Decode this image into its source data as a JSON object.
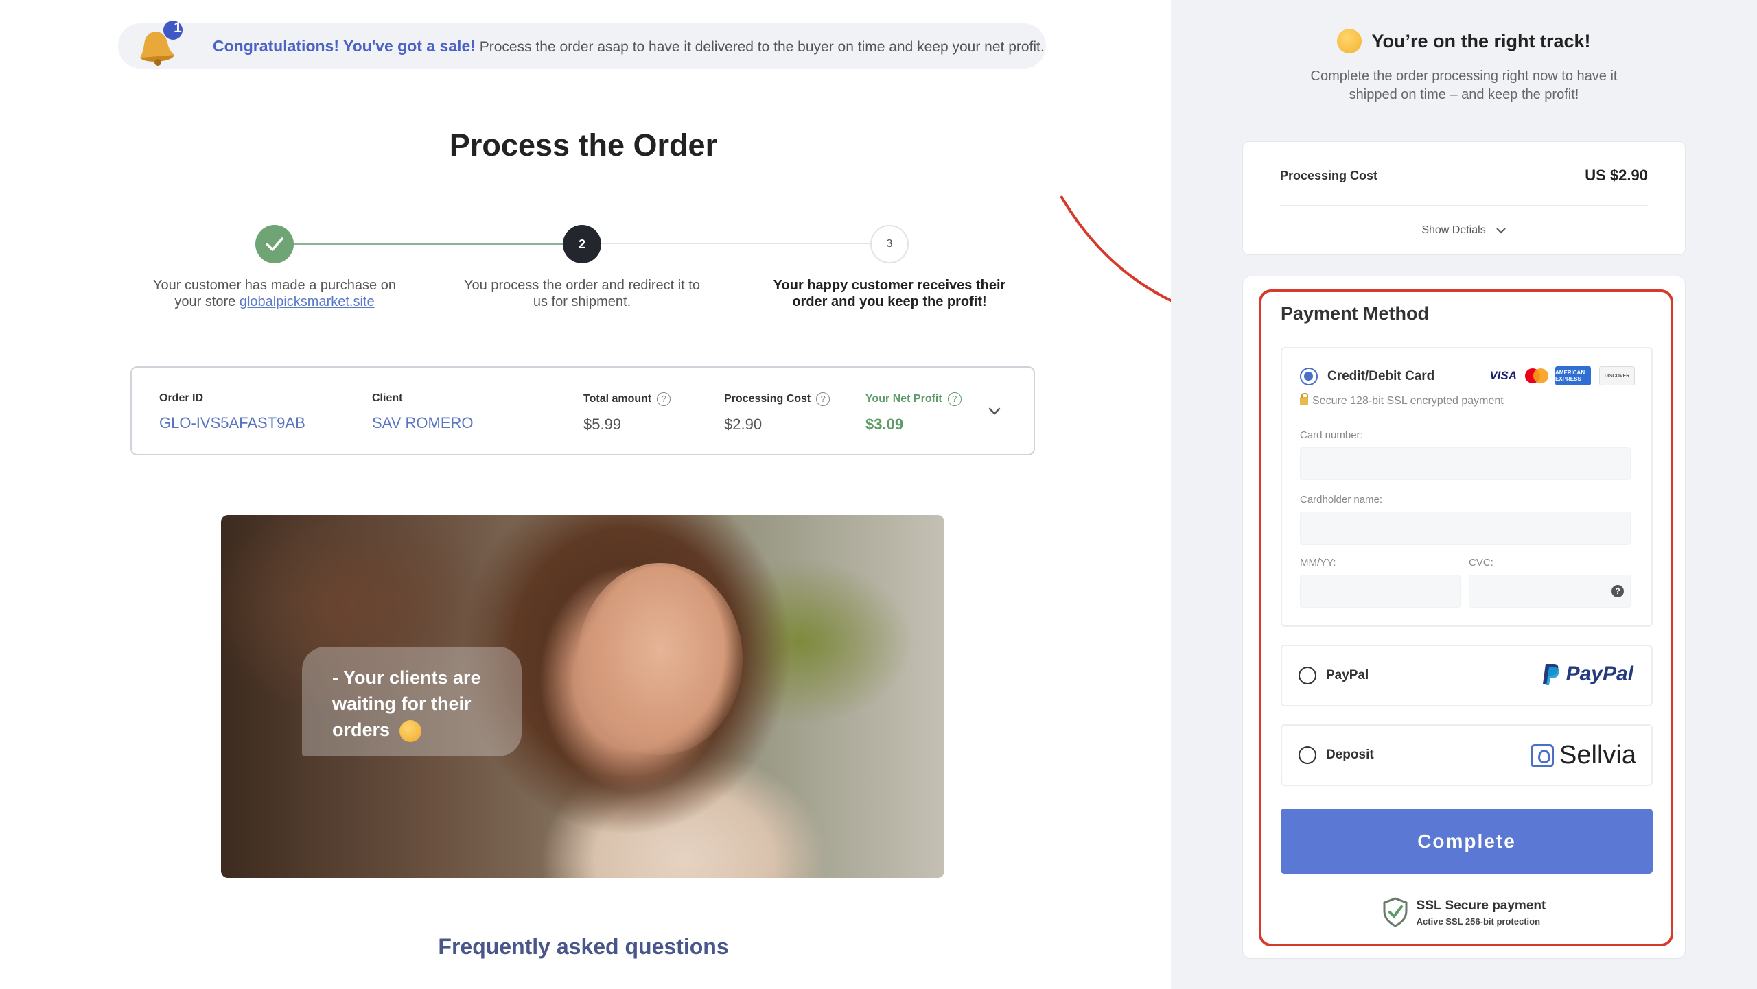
{
  "banner": {
    "badge": "1",
    "highlight": "Congratulations! You've got a sale!",
    "message": "Process the order asap to have it delivered to the buyer on time and keep your net profit."
  },
  "page": {
    "title": "Process the Order"
  },
  "steps": [
    {
      "number": "",
      "line1": "Your customer has made a purchase on",
      "line2_prefix": "your store ",
      "link": "globalpicksmarket.site",
      "state": "done"
    },
    {
      "number": "2",
      "line1": "You process the order and redirect it to",
      "line2": "us for shipment.",
      "state": "current"
    },
    {
      "number": "3",
      "line1": "Your happy customer receives their",
      "line2": "order and you keep the profit!",
      "state": "upcoming"
    }
  ],
  "order": {
    "order_id_label": "Order ID",
    "order_id": "GLO-IVS5AFAST9AB",
    "client_label": "Client",
    "client": "SAV ROMERO",
    "total_label": "Total amount",
    "total": "$5.99",
    "processing_label": "Processing Cost",
    "processing": "$2.90",
    "profit_label": "Your Net Profit",
    "profit": "$3.09"
  },
  "hero": {
    "bubble_text": "- Your clients are waiting for their orders"
  },
  "faq": {
    "title": "Frequently asked questions"
  },
  "side": {
    "title": "You’re on the right track!",
    "subtitle_line1": "Complete the order processing right now to have it",
    "subtitle_line2": "shipped on time – and keep the profit!",
    "cost_label": "Processing Cost",
    "cost_value": "US $2.90",
    "show_details": "Show Detials",
    "payment_title": "Payment Method",
    "card_option": "Credit/Debit Card",
    "ssl_note": "Secure 128-bit SSL encrypted payment",
    "card_number_label": "Card number:",
    "cardholder_label": "Cardholder name:",
    "expiry_label": "MM/YY:",
    "cvc_label": "CVC:",
    "paypal_option": "PayPal",
    "paypal_logo": "PayPal",
    "deposit_option": "Deposit",
    "sellvia_logo": "Sellvia",
    "complete_button": "Complete",
    "ssl_title": "SSL Secure payment",
    "ssl_sub": "Active SSL 256-bit protection"
  },
  "card_logos": [
    "VISA",
    "mastercard",
    "AMERICAN EXPRESS",
    "DISCOVER"
  ],
  "colors": {
    "accent": "#5a78d4",
    "success": "#5d9c68",
    "highlight_frame": "#d63a2a",
    "link": "#5a79c8"
  }
}
